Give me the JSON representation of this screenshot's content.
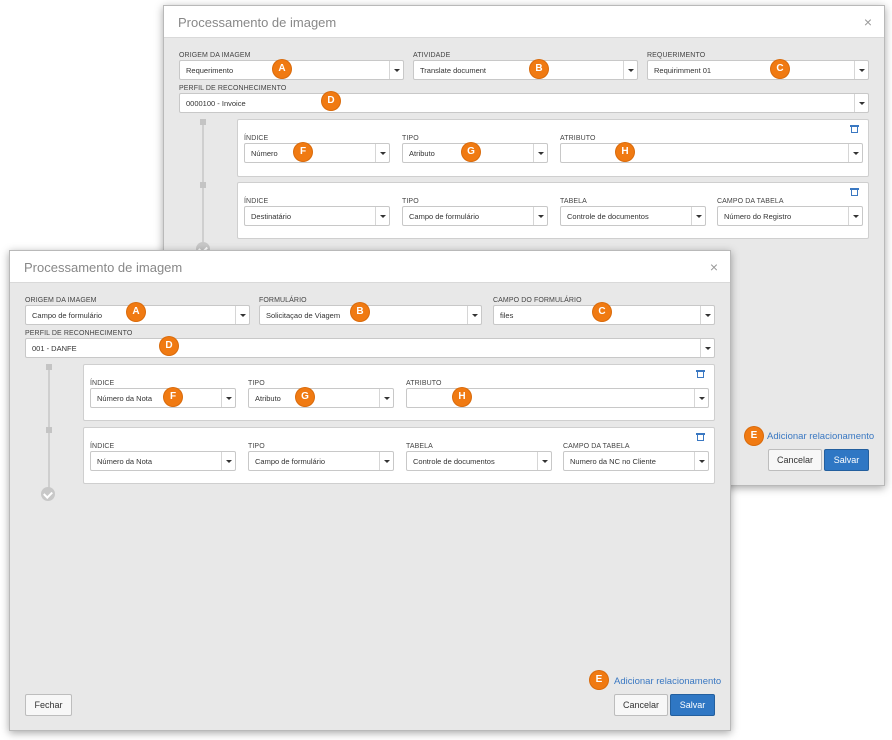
{
  "back_dialog": {
    "title": "Processamento de imagem",
    "close_glyph": "×",
    "fields": {
      "origem_label": "ORIGEM DA IMAGEM",
      "origem_value": "Requerimento",
      "atividade_label": "ATIVIDADE",
      "atividade_value": "Translate document",
      "requerimento_label": "REQUERIMENTO",
      "requerimento_value": "Requirimment 01",
      "perfil_label": "PERFIL DE RECONHECIMENTO",
      "perfil_value": "0000100 - Invoice"
    },
    "card1": {
      "indice_label": "ÍNDICE",
      "indice_value": "Número",
      "tipo_label": "TIPO",
      "tipo_value": "Atributo",
      "atributo_label": "ATRIBUTO",
      "atributo_value": ""
    },
    "card2": {
      "indice_label": "ÍNDICE",
      "indice_value": "Destinatário",
      "tipo_label": "TIPO",
      "tipo_value": "Campo de formulário",
      "tabela_label": "TABELA",
      "tabela_value": "Controle de documentos",
      "campo_label": "CAMPO DA TABELA",
      "campo_value": "Número do Registro"
    },
    "add_link": "Adicionar relacionamento",
    "cancel": "Cancelar",
    "save": "Salvar"
  },
  "front_dialog": {
    "title": "Processamento de imagem",
    "close_glyph": "×",
    "fields": {
      "origem_label": "ORIGEM DA IMAGEM",
      "origem_value": "Campo de formulário",
      "formulario_label": "FORMULÁRIO",
      "formulario_value": "Solicitaçao de Viagem",
      "campo_form_label": "CAMPO DO FORMULÁRIO",
      "campo_form_value": "files",
      "perfil_label": "PERFIL DE RECONHECIMENTO",
      "perfil_value": "001 - DANFE"
    },
    "card1": {
      "indice_label": "ÍNDICE",
      "indice_value": "Número da Nota",
      "tipo_label": "TIPO",
      "tipo_value": "Atributo",
      "atributo_label": "ATRIBUTO",
      "atributo_value": ""
    },
    "card2": {
      "indice_label": "ÍNDICE",
      "indice_value": "Número da Nota",
      "tipo_label": "TIPO",
      "tipo_value": "Campo de formulário",
      "tabela_label": "TABELA",
      "tabela_value": "Controle de documentos",
      "campo_label": "CAMPO DA TABELA",
      "campo_value": "Numero da NC no Cliente"
    },
    "add_link": "Adicionar relacionamento",
    "close_btn": "Fechar",
    "cancel": "Cancelar",
    "save": "Salvar"
  },
  "badges": {
    "a": "A",
    "b": "B",
    "c": "C",
    "d": "D",
    "e": "E",
    "f": "F",
    "g": "G",
    "h": "H"
  },
  "icons": {
    "trash": "trash-icon",
    "caret": "chevron-down-icon",
    "check": "check-circle-icon"
  },
  "colors": {
    "badge": "#f07a12",
    "primary": "#2f77c4",
    "link": "#3a78c2"
  }
}
